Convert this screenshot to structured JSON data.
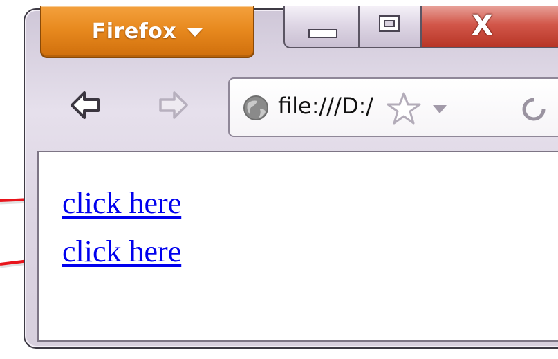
{
  "titlebar": {
    "app_button_label": "Firefox",
    "app_button_icon": "chevron-down-icon",
    "minimize_icon": "minimize-icon",
    "maximize_icon": "maximize-icon",
    "close_glyph": "X"
  },
  "toolbar": {
    "back_icon": "back-arrow-icon",
    "forward_icon": "forward-arrow-icon",
    "url": "file:///D:/",
    "site_icon": "globe-icon",
    "bookmark_icon": "star-icon",
    "history_icon": "dropdown-icon",
    "reload_icon": "reload-icon"
  },
  "content": {
    "links": [
      {
        "text": "click here"
      },
      {
        "text": "click here"
      }
    ]
  },
  "colors": {
    "link": "#0000ee",
    "firefox_button": "#e88a1f",
    "close_button": "#d2574a",
    "annotation_arrow": "#e8141b"
  }
}
